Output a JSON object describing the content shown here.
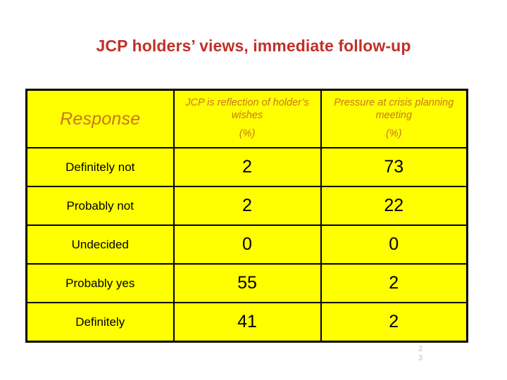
{
  "slide": {
    "title": "JCP holders’ views, immediate follow-up",
    "title_color": "#C13029",
    "background_color": "#FFFFFF",
    "page_number_digits": [
      "2",
      "3"
    ],
    "page_number": "23"
  },
  "table": {
    "fill_color": "#FFFF00",
    "border_color": "#000000",
    "header_text_color": "#C8781E",
    "body_text_color": "#000000",
    "headers": [
      {
        "label": "Response",
        "unit": ""
      },
      {
        "label": "JCP is reflection of holder’s wishes",
        "unit": "(%)"
      },
      {
        "label": "Pressure at crisis planning meeting",
        "unit": "(%)"
      }
    ],
    "rows": [
      {
        "response": "Definitely not",
        "reflection_pct": "2",
        "pressure_pct": "73"
      },
      {
        "response": "Probably not",
        "reflection_pct": "2",
        "pressure_pct": "22"
      },
      {
        "response": "Undecided",
        "reflection_pct": "0",
        "pressure_pct": "0"
      },
      {
        "response": "Probably yes",
        "reflection_pct": "55",
        "pressure_pct": "2"
      },
      {
        "response": "Definitely",
        "reflection_pct": "41",
        "pressure_pct": "2"
      }
    ]
  }
}
